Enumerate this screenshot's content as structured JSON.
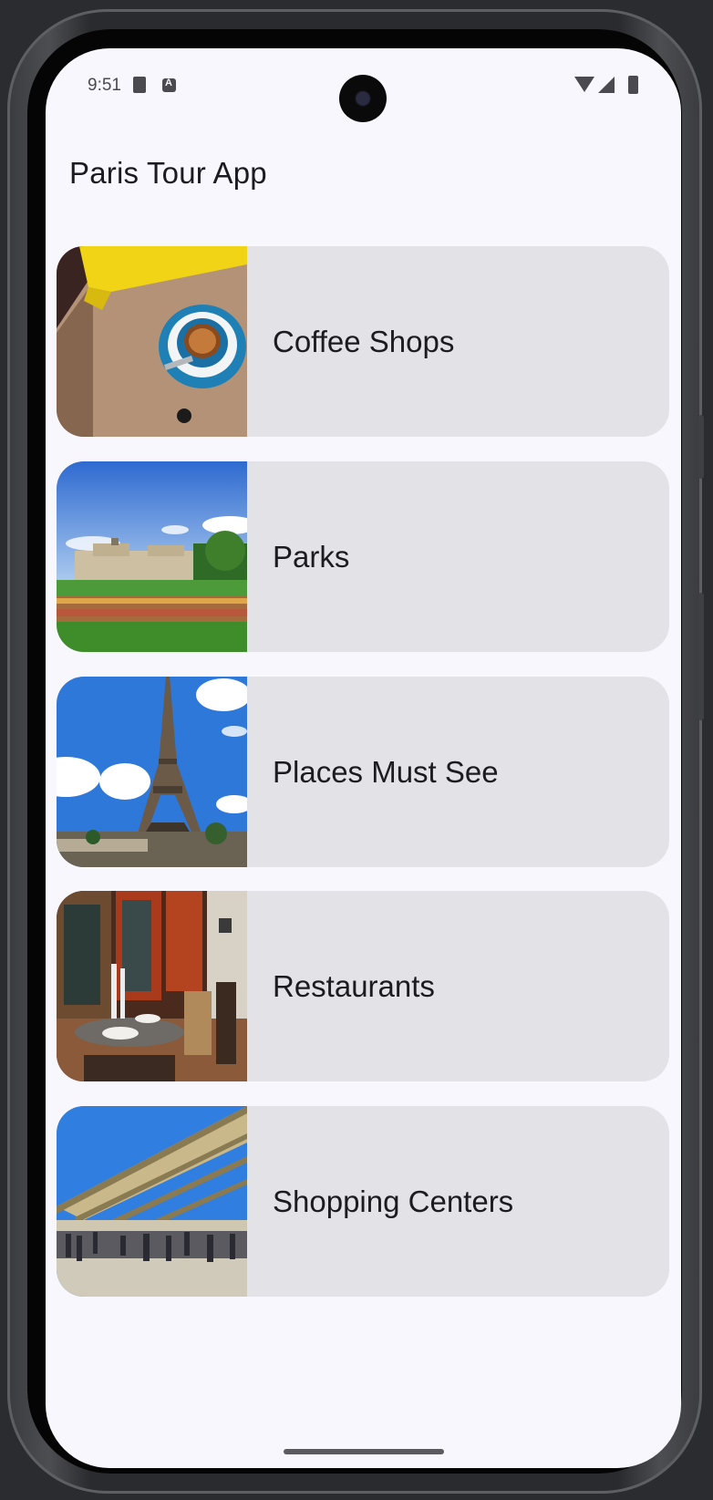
{
  "status_bar": {
    "time": "9:51",
    "icons": [
      "sd-card-icon",
      "a-badge-icon",
      "wifi-icon",
      "signal-icon",
      "battery-icon"
    ]
  },
  "app_bar": {
    "title": "Paris Tour App"
  },
  "categories": [
    {
      "label": "Coffee Shops",
      "image": "coffee-cup-photo"
    },
    {
      "label": "Parks",
      "image": "park-palace-photo"
    },
    {
      "label": "Places Must See",
      "image": "eiffel-tower-photo"
    },
    {
      "label": "Restaurants",
      "image": "restaurant-interior-photo"
    },
    {
      "label": "Shopping Centers",
      "image": "shopping-center-photo"
    }
  ],
  "colors": {
    "background": "#f8f7fd",
    "card": "#e2e2e7",
    "text": "#1c1b1f"
  }
}
